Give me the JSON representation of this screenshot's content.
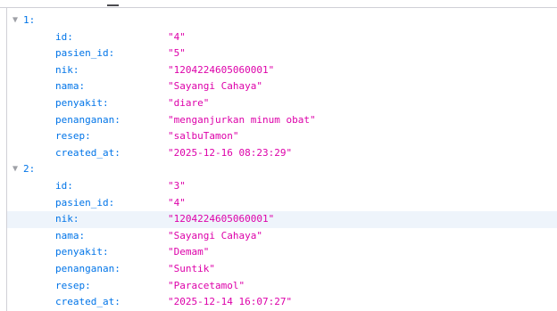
{
  "records": [
    {
      "key": "1:",
      "fields": [
        {
          "key": "id:",
          "value": "\"4\""
        },
        {
          "key": "pasien_id:",
          "value": "\"5\""
        },
        {
          "key": "nik:",
          "value": "\"1204224605060001\""
        },
        {
          "key": "nama:",
          "value": "\"Sayangi Cahaya\""
        },
        {
          "key": "penyakit:",
          "value": "\"diare\""
        },
        {
          "key": "penanganan:",
          "value": "\"menganjurkan minum obat\""
        },
        {
          "key": "resep:",
          "value": "\"salbuTamon\""
        },
        {
          "key": "created_at:",
          "value": "\"2025-12-16 08:23:29\""
        }
      ]
    },
    {
      "key": "2:",
      "fields": [
        {
          "key": "id:",
          "value": "\"3\""
        },
        {
          "key": "pasien_id:",
          "value": "\"4\""
        },
        {
          "key": "nik:",
          "value": "\"1204224605060001\""
        },
        {
          "key": "nama:",
          "value": "\"Sayangi Cahaya\""
        },
        {
          "key": "penyakit:",
          "value": "\"Demam\""
        },
        {
          "key": "penanganan:",
          "value": "\"Suntik\""
        },
        {
          "key": "resep:",
          "value": "\"Paracetamol\""
        },
        {
          "key": "created_at:",
          "value": "\"2025-12-14 16:07:27\""
        }
      ]
    }
  ],
  "icons": {
    "expanded_toggle": "triangle-down"
  },
  "colors": {
    "key": "#0074e8",
    "string_value": "#dd00a9",
    "toggle": "#9ea0a6",
    "hover_row": "#eef4fb"
  }
}
